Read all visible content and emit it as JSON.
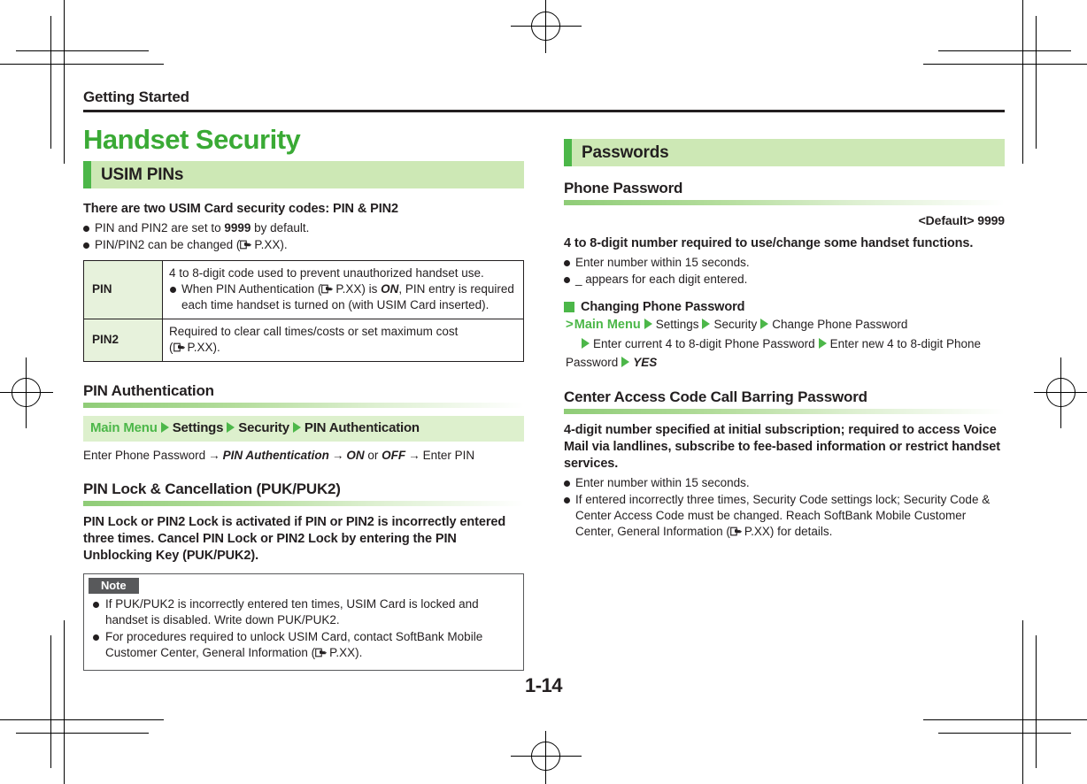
{
  "header": {
    "running_head": "Getting Started",
    "folio": "1-14"
  },
  "left_column": {
    "chapter_title": "Handset Security",
    "section_band": "USIM PINs",
    "intro_lead": "There are two USIM Card security codes: PIN & PIN2",
    "intro_bullets": [
      {
        "pre": "PIN and PIN2 are set to ",
        "bold": "9999",
        "post": " by default."
      },
      {
        "pre": "PIN/PIN2 can be changed (",
        "ref": "hand-pointer-icon",
        "post_ref": "P.XX)."
      }
    ],
    "table": {
      "rows": [
        {
          "key": "PIN",
          "line1": "4 to 8-digit code used to prevent unauthorized handset use.",
          "bullet_pre": "When PIN Authentication (",
          "bullet_ref": "hand-pointer-icon",
          "bullet_mid": "P.XX) is ",
          "bullet_em": "ON",
          "bullet_post": ", PIN entry is required each time handset is turned on (with USIM Card inserted)."
        },
        {
          "key": "PIN2",
          "line1": "Required to clear call times/costs or set maximum cost",
          "line2_pre": "(",
          "line2_ref": "hand-pointer-icon",
          "line2_post": "P.XX)."
        }
      ]
    },
    "pin_auth": {
      "heading": "PIN Authentication",
      "nav": {
        "root": "Main Menu",
        "crumbs": [
          "Settings",
          "Security",
          "PIN Authentication"
        ]
      },
      "steps": {
        "s1": "Enter Phone Password",
        "s2": "PIN Authentication",
        "s3": "ON",
        "or": "or",
        "s4": "OFF",
        "s5": "Enter PIN"
      }
    },
    "pin_lock": {
      "heading": "PIN Lock & Cancellation (PUK/PUK2)",
      "lead": "PIN Lock or PIN2 Lock is activated if PIN or PIN2 is incorrectly entered three times. Cancel PIN Lock or PIN2 Lock by entering the PIN Unblocking Key (PUK/PUK2)."
    },
    "note": {
      "label": "Note",
      "items": [
        {
          "text": "If PUK/PUK2 is incorrectly entered ten times, USIM Card is locked and handset is disabled. Write down PUK/PUK2."
        },
        {
          "pre": "For procedures required to unlock USIM Card, contact SoftBank Mobile Customer Center, General Information (",
          "ref": "hand-pointer-icon",
          "post": "P.XX)."
        }
      ]
    }
  },
  "right_column": {
    "section_band": "Passwords",
    "phone_password": {
      "heading": "Phone Password",
      "default_line": "<Default> 9999",
      "lead": "4 to 8-digit number required to use/change some handset functions.",
      "bullets": [
        "Enter number within 15 seconds.",
        "_ appears for each digit entered."
      ],
      "sub_sub": "Changing Phone Password",
      "procedure": {
        "root": "Main Menu",
        "crumbs": [
          "Settings",
          "Security",
          "Change Phone Password",
          "Enter current 4 to 8-digit Phone Password",
          "Enter new 4 to 8-digit Phone Password",
          "YES"
        ]
      }
    },
    "center_access": {
      "heading": "Center Access Code Call Barring Password",
      "lead": "4-digit number specified at initial subscription; required to access Voice Mail via landlines, subscribe to fee-based information or restrict handset services.",
      "bullets": [
        {
          "text": "Enter number within 15 seconds."
        },
        {
          "pre": "If entered incorrectly three times, Security Code settings lock; Security Code & Center Access Code must be changed. Reach SoftBank Mobile Customer Center, General Information (",
          "ref": "hand-pointer-icon",
          "post": "P.XX) for details."
        }
      ]
    }
  },
  "colors": {
    "brand_green": "#3aaa35",
    "accent_green": "#4cb749",
    "band_green": "#cde8b5",
    "nav_band_green": "#ddf0cd",
    "table_key_green": "#e7f2dc",
    "ink": "#231f20",
    "note_gray": "#58595b"
  }
}
